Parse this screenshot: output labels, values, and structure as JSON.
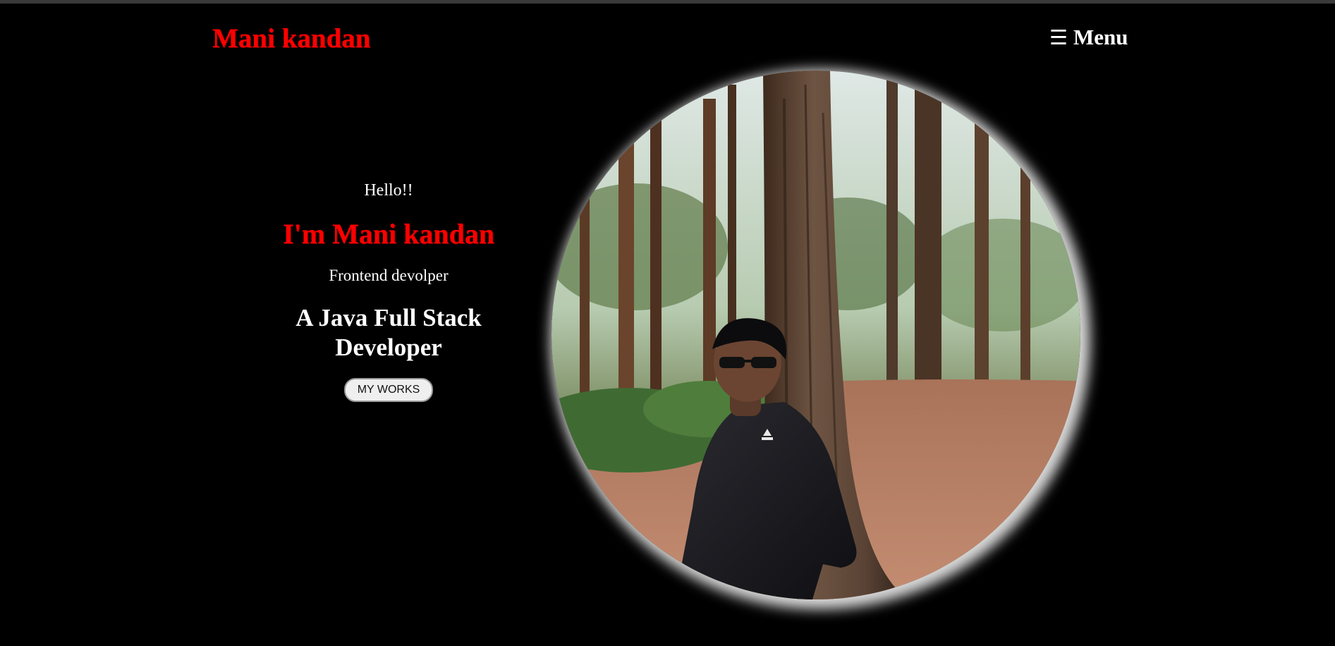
{
  "header": {
    "brand": "Mani kandan",
    "menu_icon": "hamburger-icon",
    "menu_label": "Menu"
  },
  "intro": {
    "greeting": "Hello!!",
    "name_heading": "I'm Mani kandan",
    "role": "Frontend devolper",
    "tagline_line1": "A Java Full Stack",
    "tagline_line2": "Developer",
    "cta_label": "MY WORKS"
  },
  "colors": {
    "background": "#000000",
    "accent": "#ff0000",
    "text": "#ffffff"
  }
}
